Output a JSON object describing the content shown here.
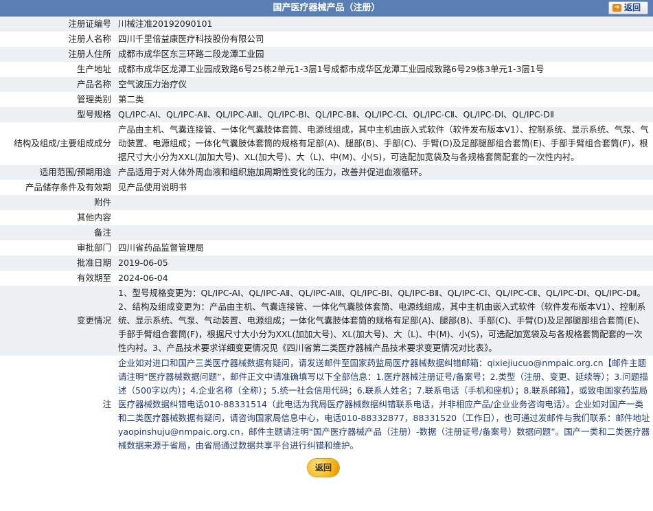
{
  "header": {
    "title": "国产医疗器械产品（注册）",
    "back_label": "返回"
  },
  "fields": {
    "reg_no": {
      "label": "注册证编号",
      "value": "川械注准20192090101"
    },
    "registrant": {
      "label": "注册人名称",
      "value": "四川千里倍益康医疗科技股份有限公司"
    },
    "address": {
      "label": "注册人住所",
      "value": "成都市成华区东三环路二段龙潭工业园"
    },
    "production": {
      "label": "生产地址",
      "value": "成都市成华区龙潭工业园成致路6号25栋2单元1-3层1号成都市成华区龙潭工业园成致路6号29栋3单元1-3层1号"
    },
    "product_name": {
      "label": "产品名称",
      "value": "空气波压力治疗仪"
    },
    "category": {
      "label": "管理类别",
      "value": "第二类"
    },
    "models": {
      "label": "型号规格",
      "value": "QL/IPC-AⅠ、QL/IPC-AⅡ、QL/IPC-AⅢ、QL/IPC-BⅠ、QL/IPC-BⅡ、QL/IPC-CⅠ、QL/IPC-CⅡ、QL/IPC-DⅠ、QL/IPC-DⅡ"
    },
    "structure": {
      "label": "结构及组成/主要组成成分",
      "value": "产品由主机、气囊连接管、一体化气囊肢体套筒、电源线组成，其中主机由嵌入式软件（软件发布版本V1）、控制系统、显示系统、气泵、气动装置、电源组成；一体化气囊肢体套筒的规格有足部(A)、腿部(B)、手部(C)、手臂(D)及足部腿部组合套筒(E)、手部手臂组合套筒(F)，根据尺寸大小分为XXL(加加大号)、XL(加大号)、大（L)、中(M)、小(S)，可选配加宽袋及与各规格套筒配套的一次性内衬。"
    },
    "scope": {
      "label": "适用范围/预期用途",
      "value": "产品适用于对人体外周血液和组织施加周期性变化的压力，改善并促进血液循环。"
    },
    "storage": {
      "label": "产品储存条件及有效期",
      "value": "见产品使用说明书"
    },
    "attachment": {
      "label": "附件",
      "value": ""
    },
    "other": {
      "label": "其他内容",
      "value": ""
    },
    "remark": {
      "label": "备注",
      "value": ""
    },
    "authority": {
      "label": "审批部门",
      "value": "四川省药品监督管理局"
    },
    "approve_date": {
      "label": "批准日期",
      "value": "2019-06-05"
    },
    "valid_until": {
      "label": "有效期至",
      "value": "2024-06-04"
    },
    "changes": {
      "label": "变更情况",
      "value": "1、型号规格变更为：QL/IPC-AⅠ、QL/IPC-AⅡ、QL/IPC-AⅢ、QL/IPC-BⅠ、QL/IPC-BⅡ、QL/IPC-CⅠ、QL/IPC-CⅡ、QL/IPC-DⅠ、QL/IPC-DⅡ。2、结构及组成变更为：产品由主机、气囊连接管、一体化气囊肢体套筒、电源线组成，其中主机由嵌入式软件（软件发布版本V1）、控制系统、显示系统、气泵、气动装置、电源组成；一体化气囊肢体套筒的规格有足部(A)、腿部(B)、手部(C)、手臂(D)及足部腿部组合套筒(E)、手部手臂组合套筒(F)，根据尺寸大小分为XXL(加加大号)、XL(加大号)、大（L)、中(M)、小(S)，可选配加宽袋及与各规格套筒配套的一次性内衬。3、产品技术要求详细变更情况见《四川省第二类医疗器械产品技术要求变更情况对比表》。"
    },
    "note": {
      "label": "注",
      "value": "企业如对进口和国产三类医疗器械数据有疑问，请发送邮件至国家药监局医疗器械数据纠错邮箱：qixiejiucuo@nmpaic.org.cn【邮件主题请注明“医疗器械数据问题”，邮件正文中请准确填写以下全部信息：1.医疗器械注册证号/备案号；2.类型（注册、变更、延续等）；3.问题描述（500字以内）；4.企业名称（全称）；5.统一社会信用代码；6.联系人姓名；7.联系电话（手机和座机）；8.联系邮箱】，或致电国家药监局医疗器械数据纠错电话010-88331514（此电话为我局医疗器械数据纠错联系电话，并非相应产品/企业业务咨询电话）。企业如对国产一类和二类医疗器械数据有疑问，请咨询国家局信息中心，电话010-88332877，88331520（工作日），也可通过发邮件与我们联系：邮件地址yaopinshuju@nmpaic.org.cn，邮件主题请注明“国产医疗器械产品（注册）-数据（注册证号/备案号）数据问题”。国产一类和二类医疗器械数据来源于省局，由省局通过数据共享平台进行纠错和维护。"
    }
  },
  "footer": {
    "back_label": "返回"
  }
}
